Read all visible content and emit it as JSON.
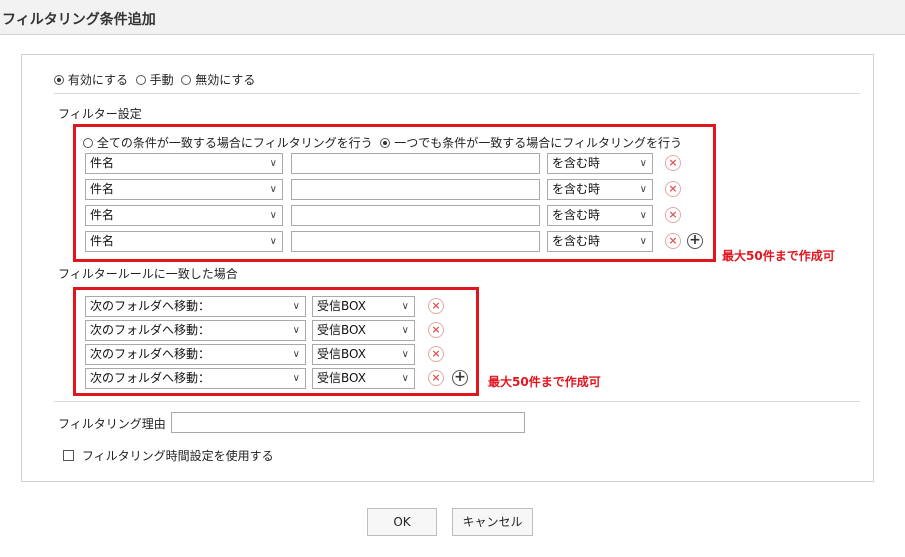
{
  "dialog_title": "フィルタリング条件追加",
  "mode": {
    "options": [
      "有効にする",
      "手動",
      "無効にする"
    ],
    "selected": 0
  },
  "filter_settings": {
    "heading": "フィルター設定",
    "match_options": [
      "全ての条件が一致する場合にフィルタリングを行う",
      "一つでも条件が一致する場合にフィルタリングを行う"
    ],
    "match_selected": 1,
    "rules": [
      {
        "field": "件名",
        "value": "",
        "condition": "を含む時"
      },
      {
        "field": "件名",
        "value": "",
        "condition": "を含む時"
      },
      {
        "field": "件名",
        "value": "",
        "condition": "を含む時"
      },
      {
        "field": "件名",
        "value": "",
        "condition": "を含む時"
      }
    ],
    "limit_note": "最大50件まで作成可"
  },
  "actions": {
    "heading": "フィルタールールに一致した場合",
    "rows": [
      {
        "action": "次のフォルダへ移動：",
        "folder": "受信BOX"
      },
      {
        "action": "次のフォルダへ移動：",
        "folder": "受信BOX"
      },
      {
        "action": "次のフォルダへ移動：",
        "folder": "受信BOX"
      },
      {
        "action": "次のフォルダへ移動：",
        "folder": "受信BOX"
      }
    ],
    "limit_note": "最大50件まで作成可"
  },
  "reason": {
    "label": "フィルタリング理由",
    "value": ""
  },
  "time_setting": {
    "label": "フィルタリング時間設定を使用する",
    "checked": false
  },
  "buttons": {
    "ok": "OK",
    "cancel": "キャンセル"
  }
}
